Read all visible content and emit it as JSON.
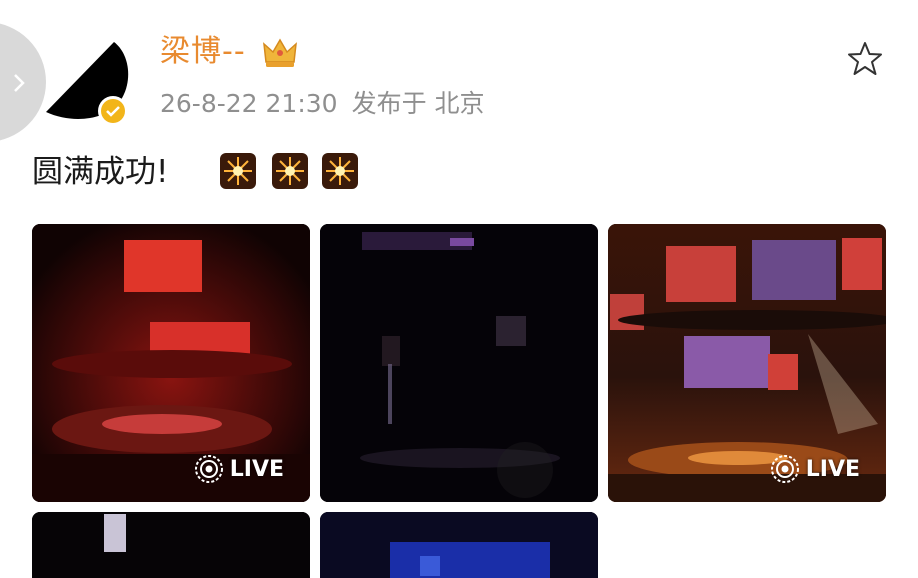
{
  "post": {
    "username": "梁博--",
    "date": "26-8-22 21:30",
    "published_at": "发布于 北京",
    "text": "圆满成功!",
    "emojis": [
      "fireworks-emoji",
      "fireworks-emoji",
      "fireworks-emoji"
    ],
    "live_label": "LIVE"
  },
  "colors": {
    "username": "#e88a2f",
    "meta": "#8f8f8f",
    "verified": "#f2b51a",
    "text": "#1b1b1b"
  },
  "icons": [
    "chevron-right-icon",
    "verified-icon",
    "crown-icon",
    "star-icon",
    "live-icon"
  ]
}
